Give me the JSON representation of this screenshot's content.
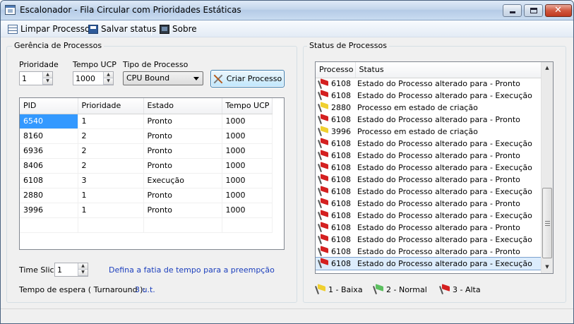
{
  "window": {
    "title": "Escalonador - Fila Circular com Prioridades Estáticas",
    "icon": "app-window-icon"
  },
  "toolbar": {
    "clear_label": "Limpar Processos",
    "save_label": "Salvar status",
    "about_label": "Sobre"
  },
  "management": {
    "group_title": "Gerência de Processos",
    "priority_label": "Prioridade",
    "priority_value": "1",
    "cpu_time_label": "Tempo UCP",
    "cpu_time_value": "1000",
    "type_label": "Tipo de Processo",
    "type_value": "CPU Bound",
    "create_button": "Criar Processo",
    "table": {
      "columns": [
        "PID",
        "Prioridade",
        "Estado",
        "Tempo UCP"
      ],
      "rows": [
        [
          "6540",
          "1",
          "Pronto",
          "1000"
        ],
        [
          "8160",
          "2",
          "Pronto",
          "1000"
        ],
        [
          "6936",
          "2",
          "Pronto",
          "1000"
        ],
        [
          "8406",
          "2",
          "Pronto",
          "1000"
        ],
        [
          "6108",
          "3",
          "Execução",
          "1000"
        ],
        [
          "2880",
          "1",
          "Pronto",
          "1000"
        ],
        [
          "3996",
          "1",
          "Pronto",
          "1000"
        ]
      ]
    },
    "time_slice_label": "Time Slice",
    "time_slice_value": "1",
    "time_slice_hint": "Defina a fatia de tempo para a preempção",
    "turnaround_label": "Tempo de espera ( Turnaround ):",
    "turnaround_value": "3 u.t."
  },
  "status": {
    "group_title": "Status de Processos",
    "columns": [
      "Processo",
      "Status"
    ],
    "rows": [
      {
        "flag": "alta",
        "process": "6108",
        "status": "Estado do Processo alterado para - Pronto"
      },
      {
        "flag": "alta",
        "process": "6108",
        "status": "Estado do Processo alterado para - Execução"
      },
      {
        "flag": "baixa",
        "process": "2880",
        "status": "Processo em estado de criação"
      },
      {
        "flag": "alta",
        "process": "6108",
        "status": "Estado do Processo alterado para - Pronto"
      },
      {
        "flag": "baixa",
        "process": "3996",
        "status": "Processo em estado de criação"
      },
      {
        "flag": "alta",
        "process": "6108",
        "status": "Estado do Processo alterado para - Execução"
      },
      {
        "flag": "alta",
        "process": "6108",
        "status": "Estado do Processo alterado para - Pronto"
      },
      {
        "flag": "alta",
        "process": "6108",
        "status": "Estado do Processo alterado para - Execução"
      },
      {
        "flag": "alta",
        "process": "6108",
        "status": "Estado do Processo alterado para - Pronto"
      },
      {
        "flag": "alta",
        "process": "6108",
        "status": "Estado do Processo alterado para - Execução"
      },
      {
        "flag": "alta",
        "process": "6108",
        "status": "Estado do Processo alterado para - Pronto"
      },
      {
        "flag": "alta",
        "process": "6108",
        "status": "Estado do Processo alterado para - Execução"
      },
      {
        "flag": "alta",
        "process": "6108",
        "status": "Estado do Processo alterado para - Pronto"
      },
      {
        "flag": "alta",
        "process": "6108",
        "status": "Estado do Processo alterado para - Execução"
      },
      {
        "flag": "alta",
        "process": "6108",
        "status": "Estado do Processo alterado para - Pronto"
      },
      {
        "flag": "alta",
        "process": "6108",
        "status": "Estado do Processo alterado para - Execução"
      }
    ],
    "legend": [
      {
        "key": "baixa",
        "label": "1 - Baixa"
      },
      {
        "key": "normal",
        "label": "2 - Normal"
      },
      {
        "key": "alta",
        "label": "3 - Alta"
      }
    ]
  },
  "colors": {
    "baixa": "#f0d030",
    "normal": "#5cc060",
    "alta": "#d42020",
    "selection": "#3399ff",
    "link": "#1c3fbd"
  }
}
